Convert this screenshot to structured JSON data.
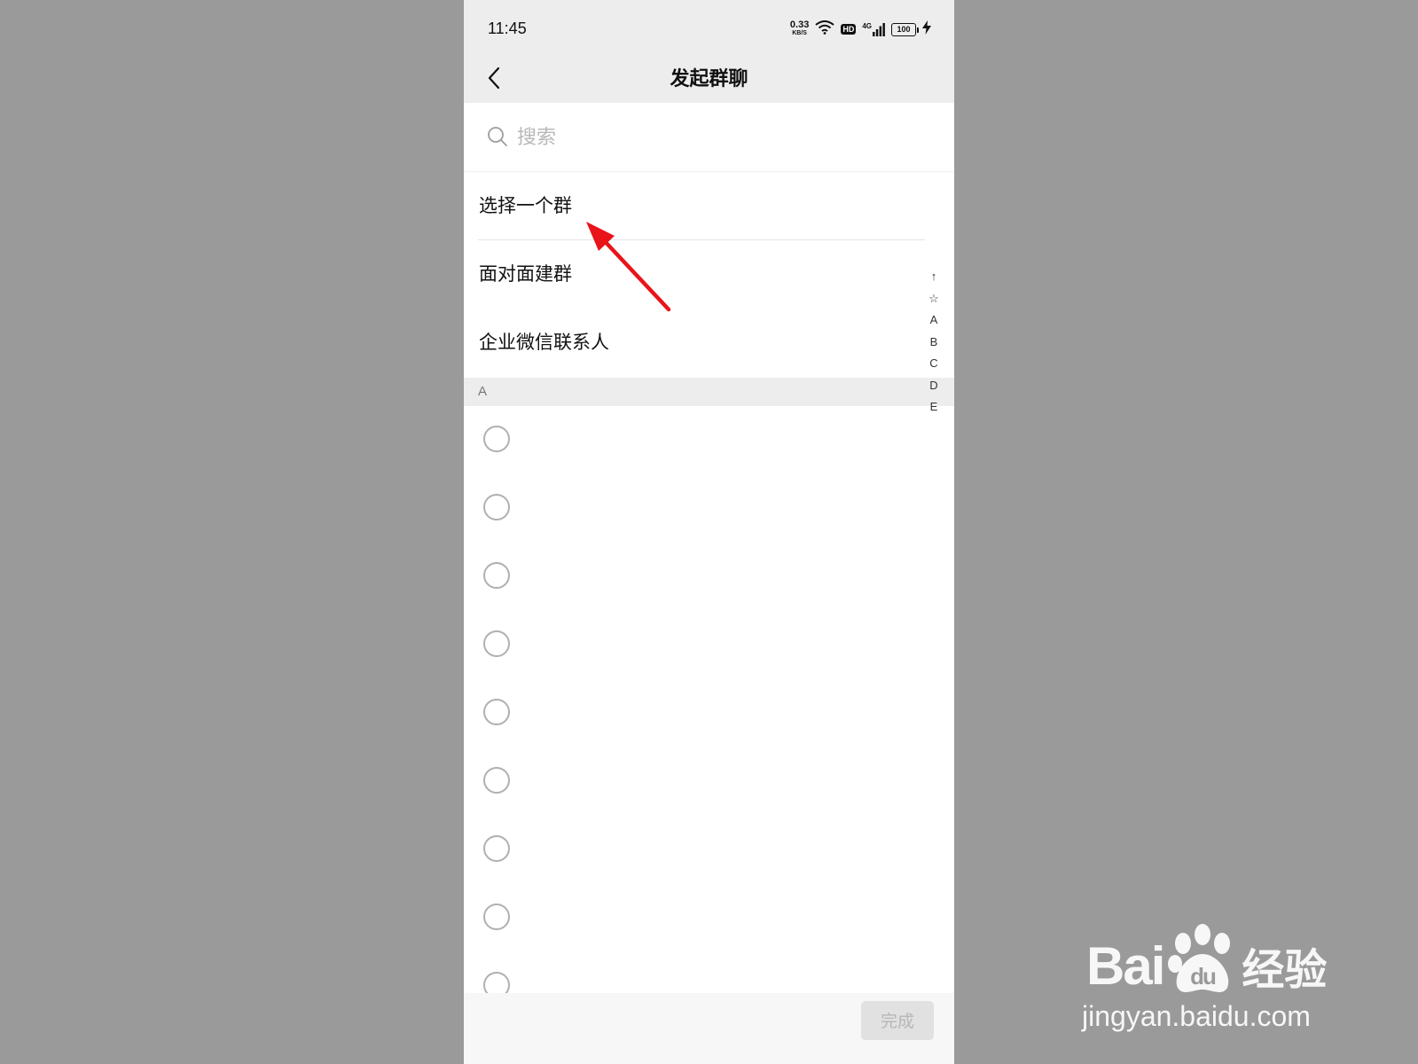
{
  "status_bar": {
    "time": "11:45",
    "net_speed_value": "0.33",
    "net_speed_unit": "KB/S",
    "hd_label": "HD",
    "network_type": "4G",
    "battery_level": "100"
  },
  "header": {
    "title": "发起群聊"
  },
  "search": {
    "placeholder": "搜索"
  },
  "menu_items": [
    {
      "label": "选择一个群"
    },
    {
      "label": "面对面建群"
    },
    {
      "label": "企业微信联系人"
    }
  ],
  "section": {
    "letter": "A"
  },
  "index_bar": [
    "↑",
    "☆",
    "A",
    "B",
    "C",
    "D",
    "E"
  ],
  "footer": {
    "done_label": "完成"
  },
  "annotation": {
    "arrow_color": "#e8141a"
  },
  "watermark": {
    "logo_text_left": "Bai",
    "logo_text_right": "经验",
    "url": "jingyan.baidu.com"
  }
}
